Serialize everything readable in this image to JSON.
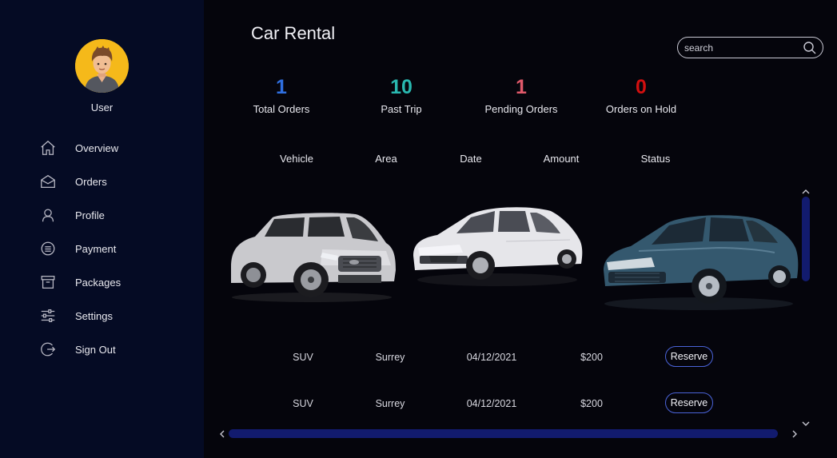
{
  "sidebar": {
    "user_name": "User",
    "items": [
      {
        "label": "Overview",
        "icon": "home-icon"
      },
      {
        "label": "Orders",
        "icon": "envelope-icon"
      },
      {
        "label": "Profile",
        "icon": "user-icon"
      },
      {
        "label": "Payment",
        "icon": "list-circle-icon"
      },
      {
        "label": "Packages",
        "icon": "archive-icon"
      },
      {
        "label": "Settings",
        "icon": "sliders-icon"
      },
      {
        "label": "Sign Out",
        "icon": "sign-out-icon"
      }
    ]
  },
  "header": {
    "title": "Car Rental",
    "search_placeholder": "search"
  },
  "stats": [
    {
      "value": "1",
      "label": "Total Orders",
      "color": "#2f6fe0"
    },
    {
      "value": "10",
      "label": "Past Trip",
      "color": "#29b8b0"
    },
    {
      "value": "1",
      "label": "Pending Orders",
      "color": "#e0596a"
    },
    {
      "value": "0",
      "label": "Orders on Hold",
      "color": "#d10f0f"
    }
  ],
  "table": {
    "columns": [
      "Vehicle",
      "Area",
      "Date",
      "Amount",
      "Status"
    ],
    "rows": [
      {
        "vehicle": "SUV",
        "area": "Surrey",
        "date": "04/12/2021",
        "amount": "$200",
        "status": "Reserve"
      },
      {
        "vehicle": "SUV",
        "area": "Surrey",
        "date": "04/12/2021",
        "amount": "$200",
        "status": "Reserve"
      }
    ]
  },
  "colors": {
    "sidebar_bg": "#050b24",
    "main_bg": "#05050c",
    "scrollbar": "#121b6e",
    "button_border": "#4a63d8",
    "avatar_bg": "#f5b91a"
  }
}
